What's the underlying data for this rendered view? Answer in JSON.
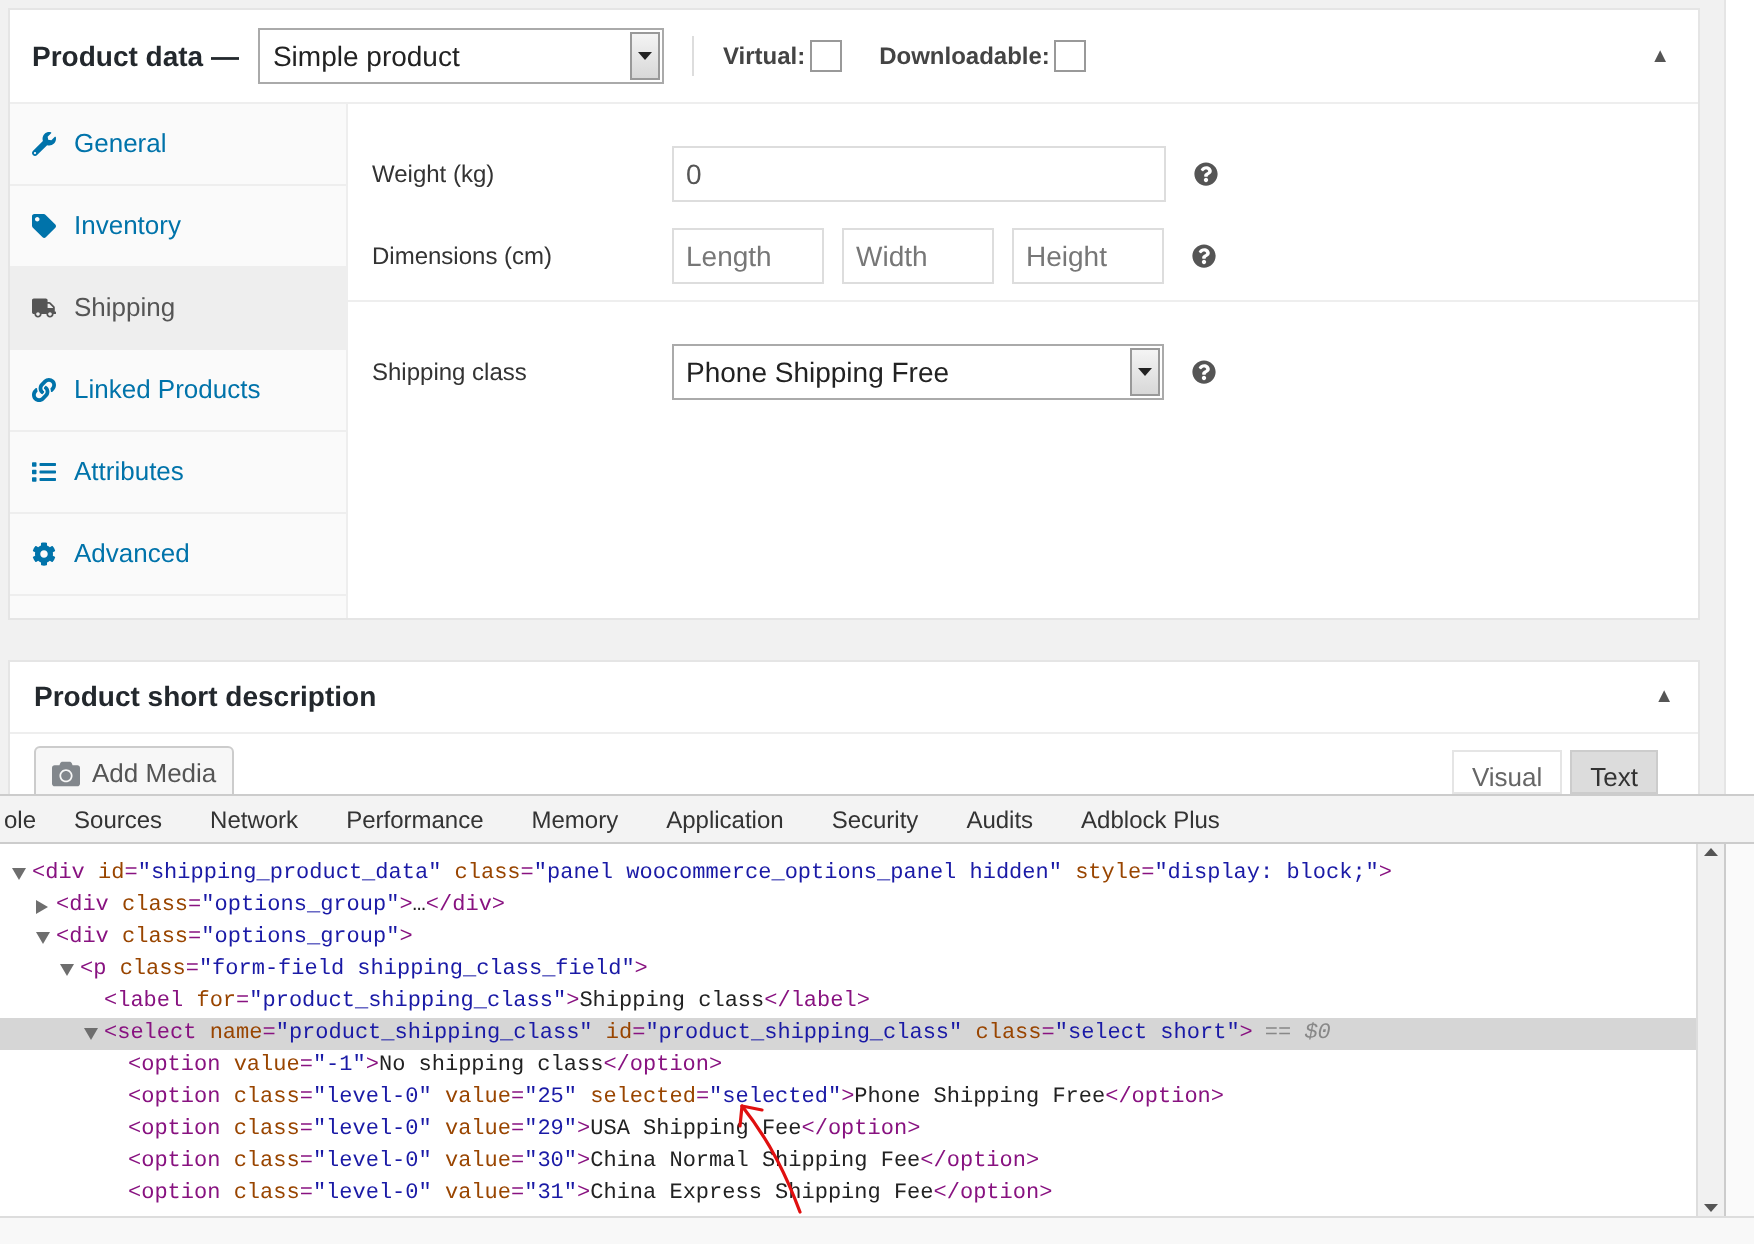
{
  "product_data": {
    "title": "Product data —",
    "type_select": {
      "value": "Simple product"
    },
    "checkboxes": [
      {
        "label": "Virtual:",
        "checked": false
      },
      {
        "label": "Downloadable:",
        "checked": false
      }
    ],
    "toggle": "▲",
    "tabs": [
      {
        "label": "General",
        "kind": "wrench",
        "selected": false
      },
      {
        "label": "Inventory",
        "kind": "tag",
        "selected": false
      },
      {
        "label": "Shipping",
        "kind": "truck",
        "selected": true
      },
      {
        "label": "Linked Products",
        "kind": "link",
        "selected": false
      },
      {
        "label": "Attributes",
        "kind": "list",
        "selected": false
      },
      {
        "label": "Advanced",
        "kind": "gear",
        "selected": false
      }
    ],
    "fields": [
      {
        "kind": "text",
        "label": "Weight (kg)",
        "inputs": [
          {
            "value": "0"
          }
        ]
      },
      {
        "kind": "dimensions",
        "label": "Dimensions (cm)",
        "inputs": [
          {
            "placeholder": "Length"
          },
          {
            "placeholder": "Width"
          },
          {
            "placeholder": "Height"
          }
        ]
      },
      {
        "kind": "select",
        "label": "Shipping class",
        "inputs": [
          {
            "value": "Phone Shipping Free"
          }
        ]
      }
    ]
  },
  "short_description": {
    "title": "Product short description",
    "toggle": "▲",
    "add_media": "Add Media",
    "editor_tabs": [
      {
        "label": "Visual",
        "selected": false
      },
      {
        "label": "Text",
        "selected": true
      }
    ]
  },
  "devtools": {
    "tabs": [
      "ole",
      "Sources",
      "Network",
      "Performance",
      "Memory",
      "Application",
      "Security",
      "Audits",
      "Adblock Plus"
    ],
    "tree": [
      {
        "text": "<div id=\"shipping_product_data\" class=\"panel woocommerce_options_panel hidden\" style=\"display: block;\">",
        "expanded": true,
        "selected": false,
        "children": [
          {
            "text": "<div class=\"options_group\">…</div>",
            "expanded": false,
            "selected": false
          },
          {
            "text": "<div class=\"options_group\">",
            "expanded": true,
            "selected": false,
            "children": [
              {
                "text": "<p class=\"form-field shipping_class_field\">",
                "expanded": true,
                "selected": false,
                "children": [
                  {
                    "text": "<label for=\"product_shipping_class\">Shipping class</label>",
                    "selected": false
                  },
                  {
                    "text": "<select name=\"product_shipping_class\" id=\"product_shipping_class\" class=\"select short\">",
                    "marker": "== $0",
                    "expanded": true,
                    "selected": true,
                    "children": [
                      {
                        "text": "<option value=\"-1\">No shipping class</option>",
                        "selected": false
                      },
                      {
                        "text": "<option class=\"level-0\" value=\"25\" selected=\"selected\">Phone Shipping Free</option>",
                        "selected": false
                      },
                      {
                        "text": "<option class=\"level-0\" value=\"29\">USA Shipping Fee</option>",
                        "selected": false
                      },
                      {
                        "text": "<option class=\"level-0\" value=\"30\">China Normal Shipping Fee</option>",
                        "selected": false
                      },
                      {
                        "text": "<option class=\"level-0\" value=\"31\">China Express Shipping Fee</option>",
                        "selected": false
                      }
                    ]
                  }
                ]
              }
            ]
          }
        ]
      }
    ]
  }
}
